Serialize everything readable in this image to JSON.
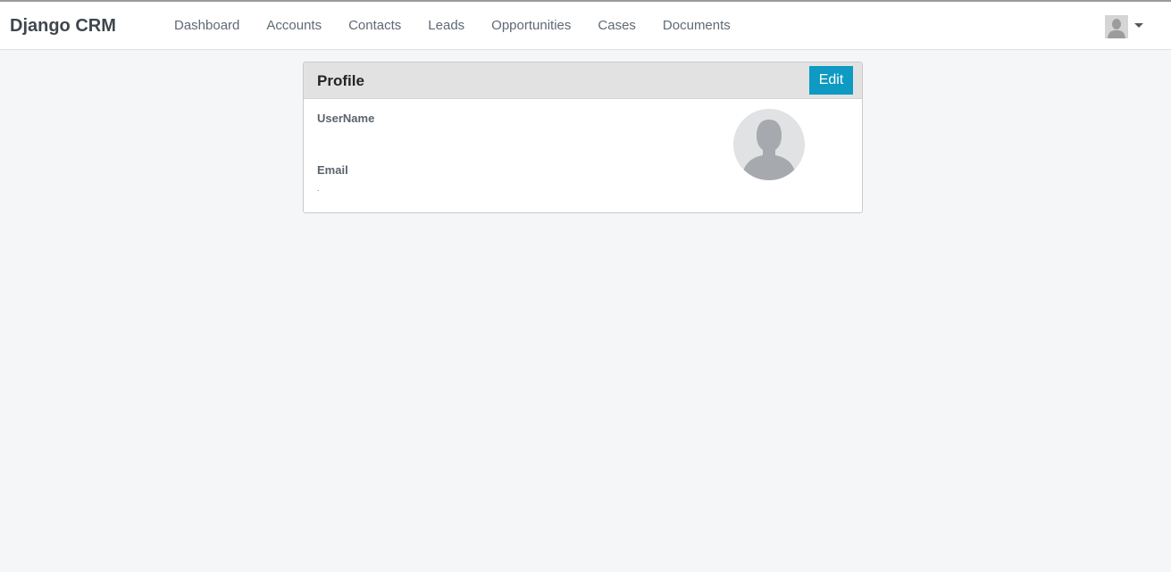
{
  "app": {
    "brand": "Django CRM"
  },
  "nav": {
    "items": [
      {
        "label": "Dashboard"
      },
      {
        "label": "Accounts"
      },
      {
        "label": "Contacts"
      },
      {
        "label": "Leads"
      },
      {
        "label": "Opportunities"
      },
      {
        "label": "Cases"
      },
      {
        "label": "Documents"
      }
    ]
  },
  "user_menu": {
    "avatar_icon": "user-silhouette-icon",
    "caret_icon": "caret-down-icon"
  },
  "profile": {
    "title": "Profile",
    "edit_label": "Edit",
    "username_label": "UserName",
    "username_value": "",
    "email_label": "Email",
    "email_value": ".",
    "avatar_icon": "user-silhouette-icon"
  },
  "colors": {
    "accent": "#0e9ac2",
    "page_bg": "#f5f6f8",
    "card_header_bg": "#e2e2e2"
  }
}
